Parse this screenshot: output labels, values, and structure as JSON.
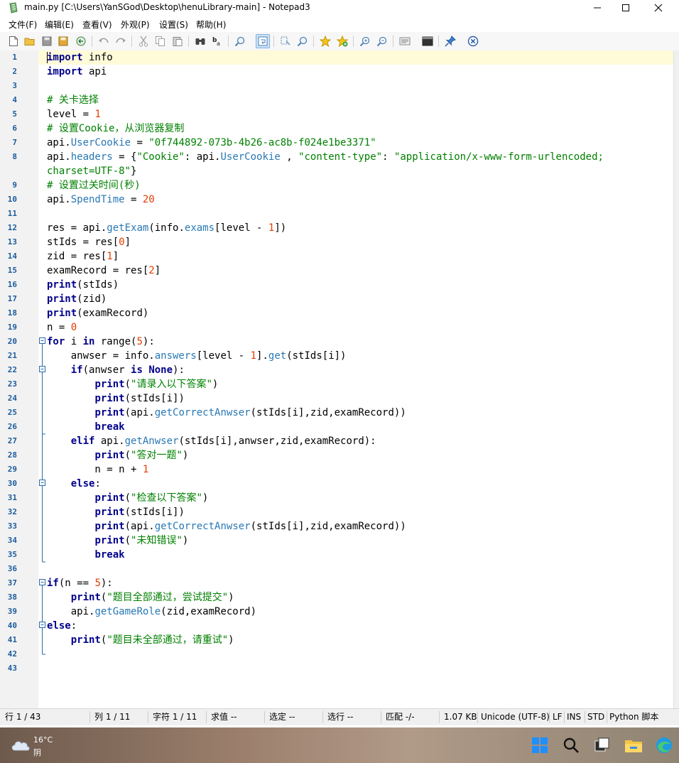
{
  "window": {
    "title": "main.py [C:\\Users\\YanSGod\\Desktop\\henuLibrary-main] - Notepad3"
  },
  "menu": [
    "文件(F)",
    "编辑(E)",
    "查看(V)",
    "外观(P)",
    "设置(S)",
    "帮助(H)"
  ],
  "toolbar_icons": [
    "new-file",
    "open-folder",
    "save",
    "save-all",
    "revert",
    "undo",
    "redo",
    "cut",
    "copy",
    "paste",
    "find",
    "replace",
    "zoom-find",
    "word-wrap",
    "select-column",
    "find-next",
    "star-bookmark",
    "star-add",
    "zoom-in",
    "zoom-out",
    "view-whitespace",
    "terminal",
    "pin",
    "close-circle"
  ],
  "editor": {
    "lines": [
      [
        [
          "kw",
          "import"
        ],
        [
          "t",
          " info"
        ]
      ],
      [
        [
          "kw",
          "import"
        ],
        [
          "t",
          " api"
        ]
      ],
      [],
      [
        [
          "cm",
          "# 关卡选择"
        ]
      ],
      [
        [
          "t",
          "level = "
        ],
        [
          "num",
          "1"
        ]
      ],
      [
        [
          "cm",
          "# 设置Cookie，从浏览器复制"
        ]
      ],
      [
        [
          "t",
          "api."
        ],
        [
          "fn",
          "UserCookie"
        ],
        [
          "t",
          " = "
        ],
        [
          "str",
          "\"0f744892-073b-4b26-ac8b-f024e1be3371\""
        ]
      ],
      [
        [
          "t",
          "api."
        ],
        [
          "fn",
          "headers"
        ],
        [
          "t",
          " = {"
        ],
        [
          "str",
          "\"Cookie\""
        ],
        [
          "t",
          ": api."
        ],
        [
          "fn",
          "UserCookie"
        ],
        [
          "t",
          " , "
        ],
        [
          "str",
          "\"content-type\""
        ],
        [
          "t",
          ": "
        ],
        [
          "str",
          "\"application/x-www-form-urlencoded;"
        ]
      ],
      [
        [
          "str",
          "charset=UTF-8\""
        ],
        [
          "t",
          "}"
        ]
      ],
      [
        [
          "cm",
          "# 设置过关时间(秒)"
        ]
      ],
      [
        [
          "t",
          "api."
        ],
        [
          "fn",
          "SpendTime"
        ],
        [
          "t",
          " = "
        ],
        [
          "num",
          "20"
        ]
      ],
      [],
      [
        [
          "t",
          "res = api."
        ],
        [
          "fn",
          "getExam"
        ],
        [
          "t",
          "(info."
        ],
        [
          "fn",
          "exams"
        ],
        [
          "t",
          "[level - "
        ],
        [
          "num",
          "1"
        ],
        [
          "t",
          "])"
        ]
      ],
      [
        [
          "t",
          "stIds = res["
        ],
        [
          "num",
          "0"
        ],
        [
          "t",
          "]"
        ]
      ],
      [
        [
          "t",
          "zid = res["
        ],
        [
          "num",
          "1"
        ],
        [
          "t",
          "]"
        ]
      ],
      [
        [
          "t",
          "examRecord = res["
        ],
        [
          "num",
          "2"
        ],
        [
          "t",
          "]"
        ]
      ],
      [
        [
          "kw",
          "print"
        ],
        [
          "t",
          "(stIds)"
        ]
      ],
      [
        [
          "kw",
          "print"
        ],
        [
          "t",
          "(zid)"
        ]
      ],
      [
        [
          "kw",
          "print"
        ],
        [
          "t",
          "(examRecord)"
        ]
      ],
      [
        [
          "t",
          "n = "
        ],
        [
          "num",
          "0"
        ]
      ],
      [
        [
          "kw",
          "for"
        ],
        [
          "t",
          " i "
        ],
        [
          "kw",
          "in"
        ],
        [
          "t",
          " range("
        ],
        [
          "num",
          "5"
        ],
        [
          "t",
          "):"
        ]
      ],
      [
        [
          "t",
          "    anwser = info."
        ],
        [
          "fn",
          "answers"
        ],
        [
          "t",
          "[level - "
        ],
        [
          "num",
          "1"
        ],
        [
          "t",
          "]."
        ],
        [
          "fn",
          "get"
        ],
        [
          "t",
          "(stIds[i])"
        ]
      ],
      [
        [
          "t",
          "    "
        ],
        [
          "kw",
          "if"
        ],
        [
          "t",
          "(anwser "
        ],
        [
          "kw",
          "is"
        ],
        [
          "t",
          " "
        ],
        [
          "kw",
          "None"
        ],
        [
          "t",
          "):"
        ]
      ],
      [
        [
          "t",
          "        "
        ],
        [
          "kw",
          "print"
        ],
        [
          "t",
          "("
        ],
        [
          "str",
          "\"请录入以下答案\""
        ],
        [
          "t",
          ")"
        ]
      ],
      [
        [
          "t",
          "        "
        ],
        [
          "kw",
          "print"
        ],
        [
          "t",
          "(stIds[i])"
        ]
      ],
      [
        [
          "t",
          "        "
        ],
        [
          "kw",
          "print"
        ],
        [
          "t",
          "(api."
        ],
        [
          "fn",
          "getCorrectAnwser"
        ],
        [
          "t",
          "(stIds[i],zid,examRecord))"
        ]
      ],
      [
        [
          "t",
          "        "
        ],
        [
          "kw",
          "break"
        ]
      ],
      [
        [
          "t",
          "    "
        ],
        [
          "kw",
          "elif"
        ],
        [
          "t",
          " api."
        ],
        [
          "fn",
          "getAnwser"
        ],
        [
          "t",
          "(stIds[i],anwser,zid,examRecord):"
        ]
      ],
      [
        [
          "t",
          "        "
        ],
        [
          "kw",
          "print"
        ],
        [
          "t",
          "("
        ],
        [
          "str",
          "\"答对一题\""
        ],
        [
          "t",
          ")"
        ]
      ],
      [
        [
          "t",
          "        n = n + "
        ],
        [
          "num",
          "1"
        ]
      ],
      [
        [
          "t",
          "    "
        ],
        [
          "kw",
          "else"
        ],
        [
          "t",
          ":"
        ]
      ],
      [
        [
          "t",
          "        "
        ],
        [
          "kw",
          "print"
        ],
        [
          "t",
          "("
        ],
        [
          "str",
          "\"检查以下答案\""
        ],
        [
          "t",
          ")"
        ]
      ],
      [
        [
          "t",
          "        "
        ],
        [
          "kw",
          "print"
        ],
        [
          "t",
          "(stIds[i])"
        ]
      ],
      [
        [
          "t",
          "        "
        ],
        [
          "kw",
          "print"
        ],
        [
          "t",
          "(api."
        ],
        [
          "fn",
          "getCorrectAnwser"
        ],
        [
          "t",
          "(stIds[i],zid,examRecord))"
        ]
      ],
      [
        [
          "t",
          "        "
        ],
        [
          "kw",
          "print"
        ],
        [
          "t",
          "("
        ],
        [
          "str",
          "\"未知错误\""
        ],
        [
          "t",
          ")"
        ]
      ],
      [
        [
          "t",
          "        "
        ],
        [
          "kw",
          "break"
        ]
      ],
      [],
      [
        [
          "kw",
          "if"
        ],
        [
          "t",
          "(n == "
        ],
        [
          "num",
          "5"
        ],
        [
          "t",
          "):"
        ]
      ],
      [
        [
          "t",
          "    "
        ],
        [
          "kw",
          "print"
        ],
        [
          "t",
          "("
        ],
        [
          "str",
          "\"题目全部通过，尝试提交\""
        ],
        [
          "t",
          ")"
        ]
      ],
      [
        [
          "t",
          "    api."
        ],
        [
          "fn",
          "getGameRole"
        ],
        [
          "t",
          "(zid,examRecord)"
        ]
      ],
      [
        [
          "kw",
          "else"
        ],
        [
          "t",
          ":"
        ]
      ],
      [
        [
          "t",
          "    "
        ],
        [
          "kw",
          "print"
        ],
        [
          "t",
          "("
        ],
        [
          "str",
          "\"题目未全部通过，请重试\""
        ],
        [
          "t",
          ")"
        ]
      ],
      [],
      []
    ],
    "line_numbers": [
      "1",
      "2",
      "3",
      "4",
      "5",
      "6",
      "7",
      "8",
      "",
      "9",
      "10",
      "11",
      "12",
      "13",
      "14",
      "15",
      "16",
      "17",
      "18",
      "19",
      "20",
      "21",
      "22",
      "23",
      "24",
      "25",
      "26",
      "27",
      "28",
      "29",
      "30",
      "31",
      "32",
      "33",
      "34",
      "35",
      "36",
      "37",
      "38",
      "39",
      "40",
      "41",
      "42",
      "43"
    ]
  },
  "status": {
    "line": "行  1 / 43",
    "col": "列  1 / 11",
    "char": "字符  1 / 11",
    "value": "求值  --",
    "selection": "选定  --",
    "sel_lines": "选行  --",
    "match": "匹配  -/-",
    "size": "1.07 KB",
    "encoding": "Unicode (UTF-8)",
    "eol": "LF",
    "ins": "INS",
    "std": "STD",
    "lexer": "Python 脚本"
  },
  "taskbar": {
    "temp": "16°C",
    "weather": "阴"
  },
  "colors": {
    "keyword": "#00008b",
    "string": "#008000",
    "number": "#e53c00",
    "function": "#2878b4",
    "current_line": "#fffbd9"
  }
}
